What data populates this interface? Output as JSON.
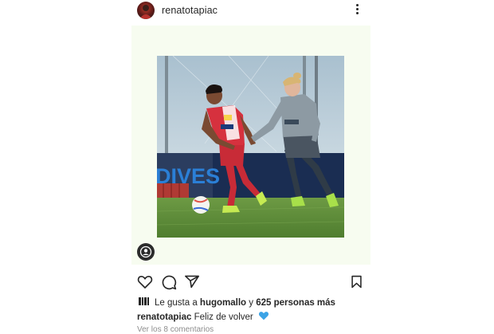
{
  "post": {
    "username": "renatotapiac",
    "image_alt": "Dos futbolistas disputando un balón sobre césped; al fondo una valla publicitaria con el texto DIVES",
    "billboard_text": "DIVES"
  },
  "likes": {
    "prefix": "Le gusta a",
    "user": "hugomallo",
    "joiner": "y",
    "count_text": "625 personas más"
  },
  "caption": {
    "username": "renatotapiac",
    "text": "Feliz de volver"
  },
  "clipped_line": "Ver los 8 comentarios",
  "icons": [
    "more-options-icon",
    "user-tag-icon",
    "heart-icon",
    "comment-icon",
    "share-icon",
    "bookmark-icon",
    "blue-heart-emoji"
  ],
  "colors": {
    "post_background": "#f7fcf0",
    "text": "#262626",
    "red_kit": "#d6313e",
    "grey_kit": "#8d9aa3",
    "grass": "#5d8a3a",
    "blue_heart": "#3ba3e6"
  }
}
